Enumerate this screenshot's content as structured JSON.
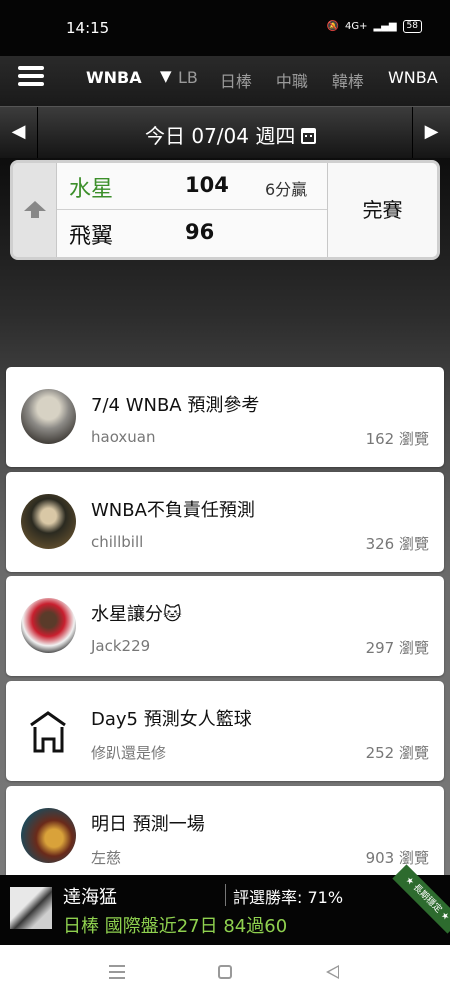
{
  "status_bar": {
    "time": "14:15",
    "network": "4G+",
    "battery": "58"
  },
  "league_nav": {
    "current": "WNBA",
    "dropdown_icon": "▼",
    "tabs": [
      {
        "label": "LB",
        "active": false
      },
      {
        "label": "日棒",
        "active": false
      },
      {
        "label": "中職",
        "active": false
      },
      {
        "label": "韓棒",
        "active": false
      },
      {
        "label": "WNBA",
        "active": true
      }
    ]
  },
  "date_nav": {
    "prev_icon": "◀",
    "next_icon": "▶",
    "label": "今日 07/04 週四"
  },
  "game": {
    "home": {
      "name": "水星",
      "score": "104",
      "margin": "6分贏",
      "color": "#3c8f2a"
    },
    "away": {
      "name": "飛翼",
      "score": "96"
    },
    "status": "完賽"
  },
  "articles": [
    {
      "title": "7/4 WNBA 預測參考",
      "author": "haoxuan",
      "views": "162 瀏覽"
    },
    {
      "title": "WNBA不負責任預測",
      "author": "chillbill",
      "views": "326 瀏覽"
    },
    {
      "title": "水星讓分🐱",
      "author": "Jack229",
      "views": "297 瀏覽"
    },
    {
      "title": "Day5 預測女人籃球",
      "author": "修趴還是修",
      "views": "252 瀏覽"
    },
    {
      "title": "明日 預測一場",
      "author": "左慈",
      "views": "903 瀏覽"
    }
  ],
  "promo": {
    "name": "達海猛",
    "rate": "評選勝率: 71%",
    "stat": "日棒 國際盤近27日 84過60",
    "ribbon": "★ 長期穩定 ★",
    "stat_color": "#8fd14f"
  }
}
